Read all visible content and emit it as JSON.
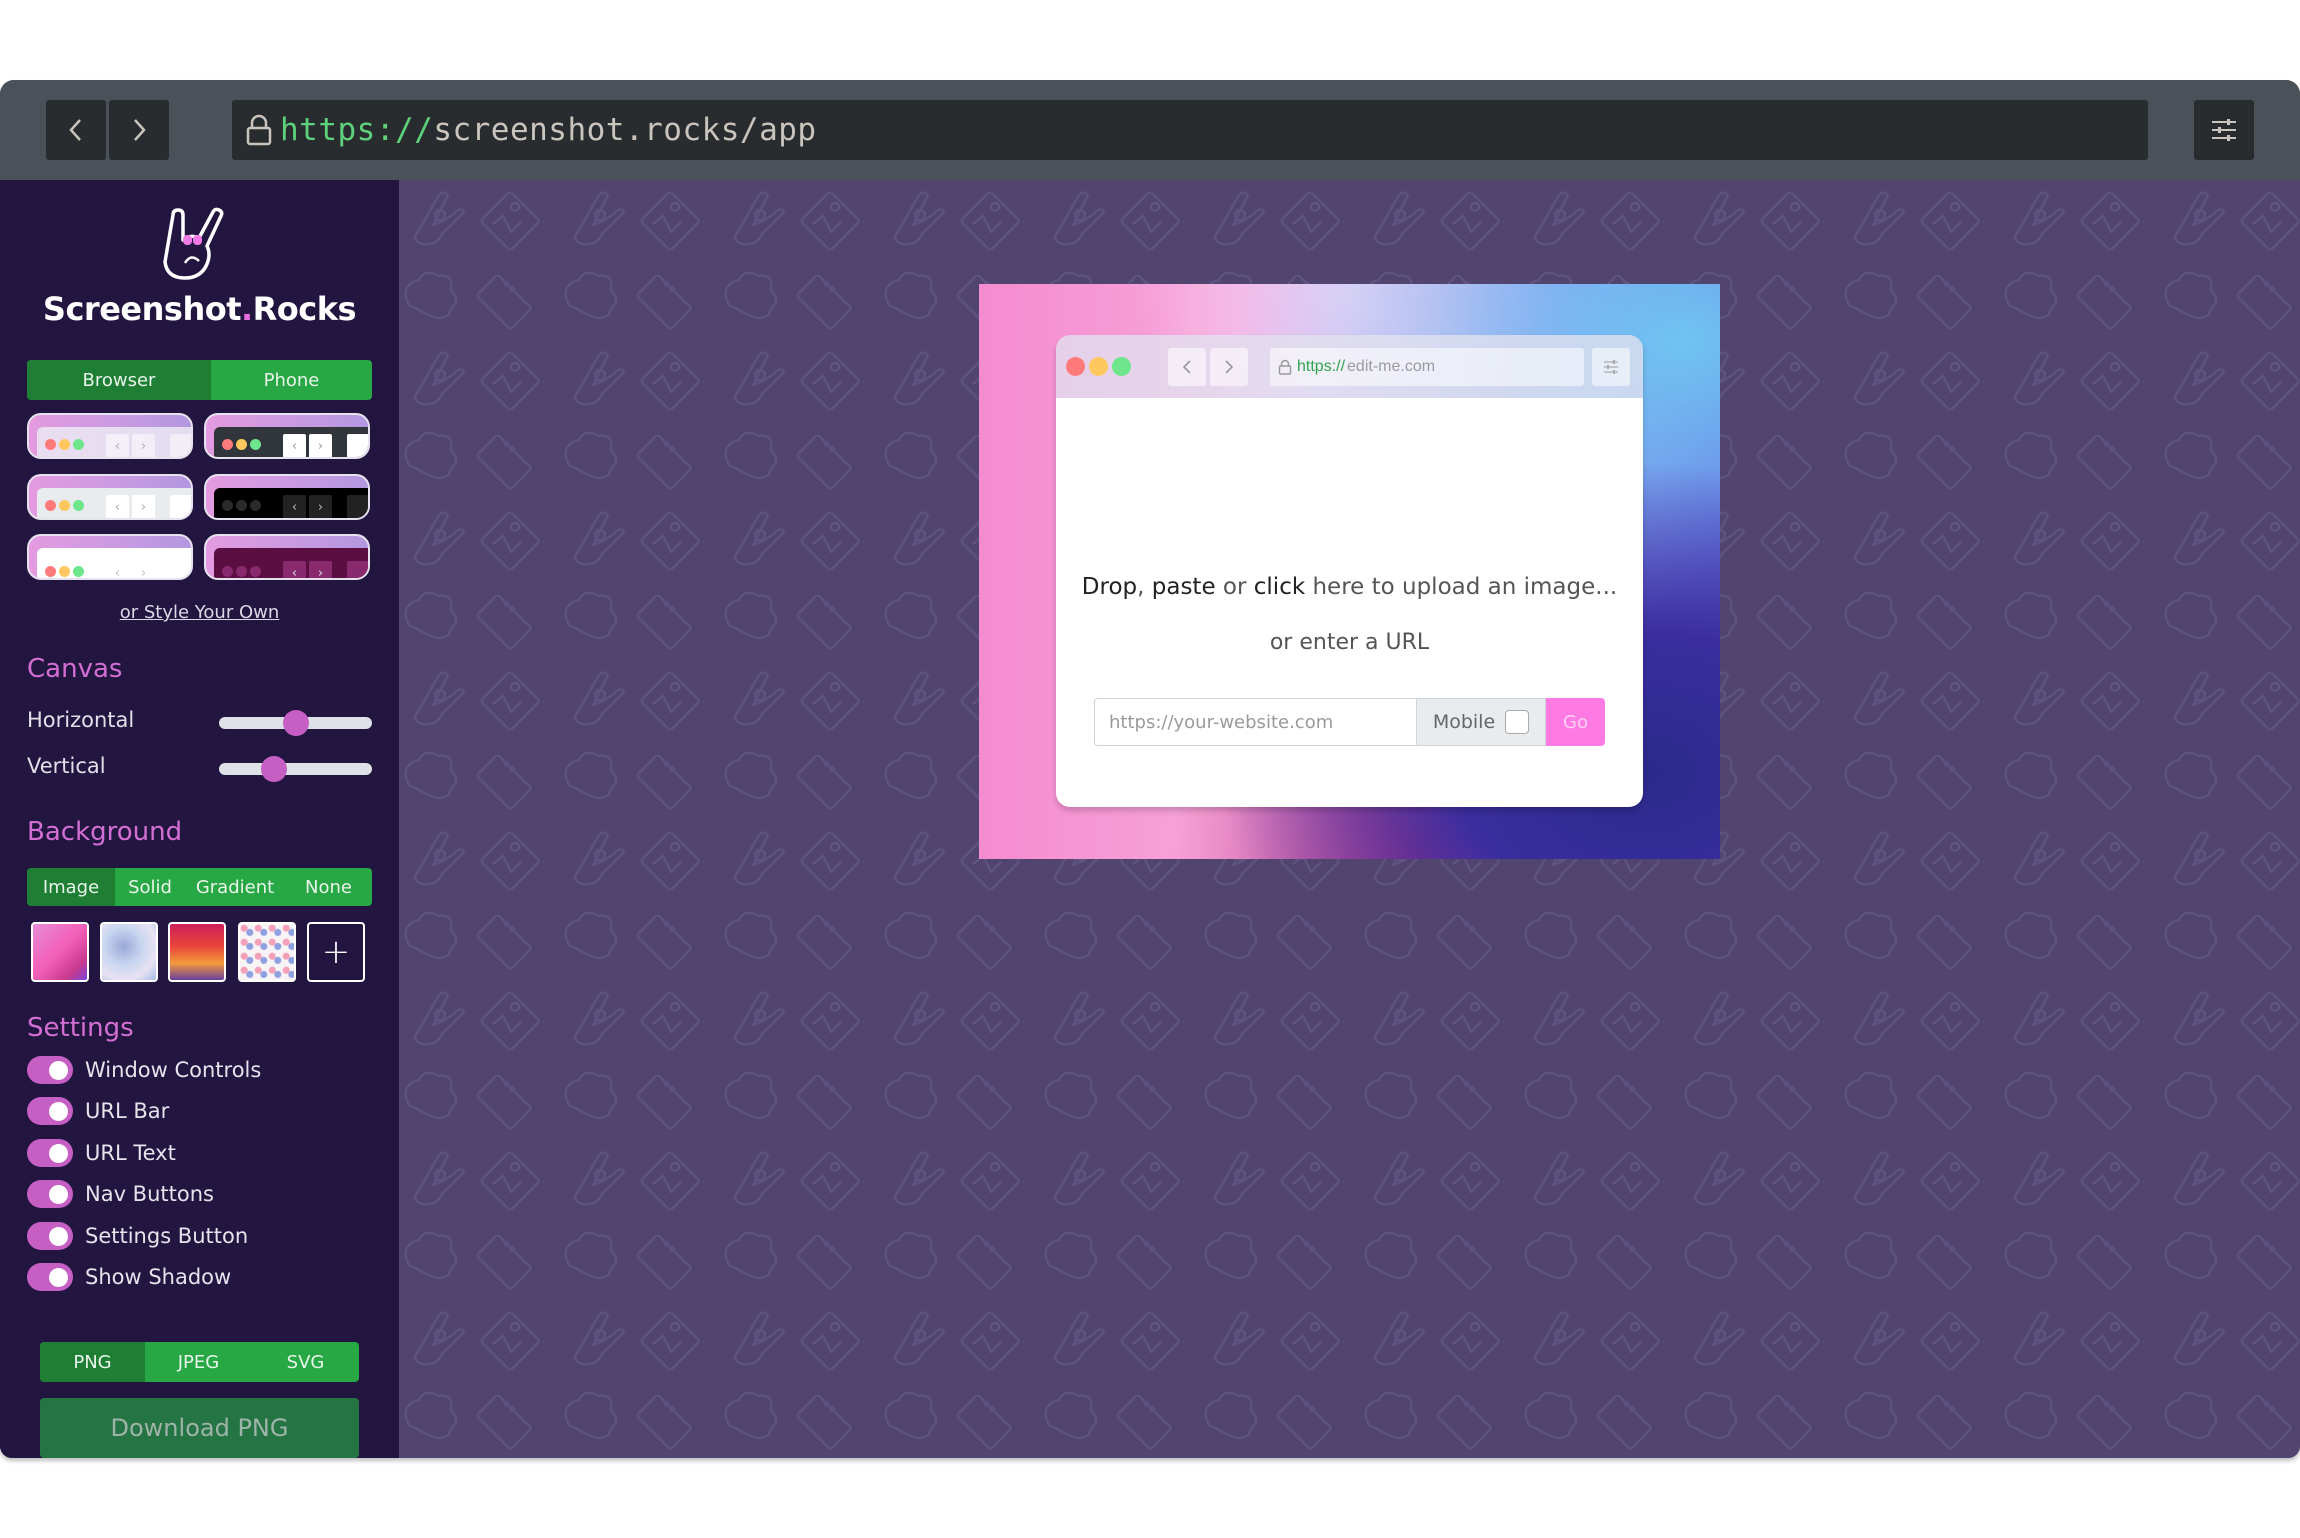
{
  "browser": {
    "url_protocol": "https://",
    "url_rest": "screenshot.rocks/app",
    "back_icon": "chevron-left-icon",
    "forward_icon": "chevron-right-icon",
    "settings_icon": "sliders-icon"
  },
  "sidebar": {
    "brand_name": "Screenshot",
    "brand_dot": ".",
    "brand_suffix": "Rocks",
    "mode_tabs": [
      {
        "label": "Browser",
        "active": true
      },
      {
        "label": "Phone",
        "active": false
      }
    ],
    "style_own_link": "or Style Your Own",
    "canvas": {
      "title": "Canvas",
      "horizontal_label": "Horizontal",
      "horizontal_value_pct": 50,
      "vertical_label": "Vertical",
      "vertical_value_pct": 36
    },
    "background": {
      "title": "Background",
      "tabs": [
        {
          "label": "Image",
          "active": true
        },
        {
          "label": "Solid",
          "active": false
        },
        {
          "label": "Gradient",
          "active": false
        },
        {
          "label": "None",
          "active": false
        }
      ],
      "add_label": "+"
    },
    "settings": {
      "title": "Settings",
      "toggles": [
        {
          "label": "Window Controls",
          "on": true
        },
        {
          "label": "URL Bar",
          "on": true
        },
        {
          "label": "URL Text",
          "on": true
        },
        {
          "label": "Nav Buttons",
          "on": true
        },
        {
          "label": "Settings Button",
          "on": true
        },
        {
          "label": "Show Shadow",
          "on": true
        }
      ]
    },
    "formats": [
      {
        "label": "PNG",
        "active": true
      },
      {
        "label": "JPEG",
        "active": false
      },
      {
        "label": "SVG",
        "active": false
      }
    ],
    "download_label": "Download PNG"
  },
  "preview": {
    "url_protocol": "https://",
    "url_rest": "edit-me.com",
    "drop_text": {
      "drop": "Drop",
      "comma": ", ",
      "paste": "paste",
      "or": " or ",
      "click": "click",
      "rest": " here to upload an image..."
    },
    "or_url": "or enter a URL",
    "url_placeholder": "https://your-website.com",
    "url_value": "",
    "mobile_label": "Mobile",
    "go_label": "Go"
  }
}
